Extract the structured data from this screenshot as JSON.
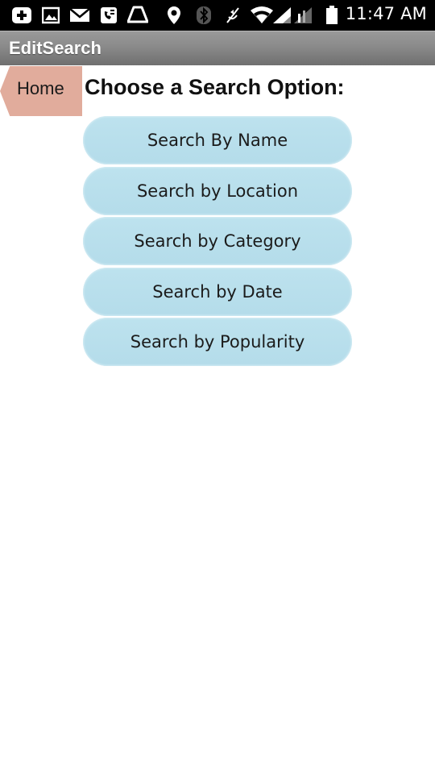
{
  "status_bar": {
    "time": "11:47 AM",
    "icons": [
      "plus-box-icon",
      "image-icon",
      "mail-icon",
      "voicemail-icon",
      "drive-icon",
      "location-pin-icon",
      "bluetooth-icon",
      "mute-icon",
      "wifi-icon",
      "signal-icon",
      "battery-icon"
    ]
  },
  "app": {
    "title": "EditSearch"
  },
  "home_button": {
    "label": "Home"
  },
  "heading": "Choose a Search Option:",
  "options": [
    {
      "label": "Search By Name"
    },
    {
      "label": "Search by Location"
    },
    {
      "label": "Search by Category"
    },
    {
      "label": "Search by Date"
    },
    {
      "label": "Search by Popularity"
    }
  ],
  "colors": {
    "home_button": "#e1ac9c",
    "option_button": "#b4dcea",
    "title_bar": "#8a8a8a",
    "status_bar": "#000000"
  }
}
